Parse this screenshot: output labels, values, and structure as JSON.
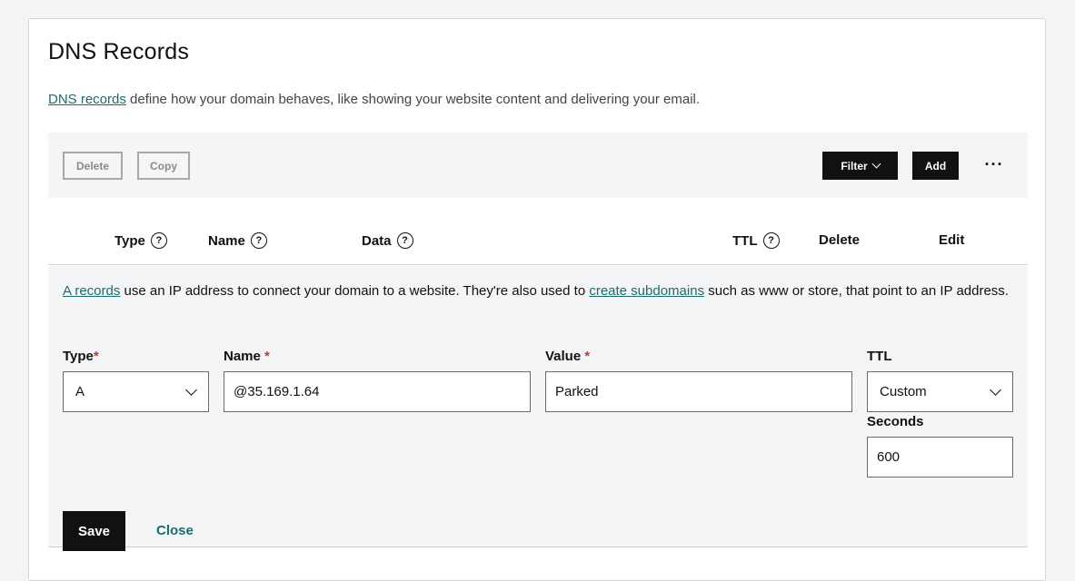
{
  "page": {
    "title": "DNS Records",
    "intro_link": "DNS records",
    "intro_text": " define how your domain behaves, like showing your website content and delivering your email."
  },
  "toolbar": {
    "delete_label": "Delete",
    "copy_label": "Copy",
    "filter_label": "Filter",
    "add_label": "Add",
    "more_label": "···"
  },
  "table_header": {
    "type": "Type",
    "name": "Name",
    "data": "Data",
    "ttl": "TTL",
    "delete": "Delete",
    "edit": "Edit",
    "help_glyph": "?"
  },
  "edit_panel": {
    "info_link1": "A records",
    "info_text1": " use an IP address to connect your domain to a website. They're also used to ",
    "info_link2": "create subdomains",
    "info_text2": " such as www or store, that point to an IP address.",
    "type_label": "Type",
    "name_label": "Name ",
    "value_label": "Value ",
    "ttl_label": "TTL",
    "required_mark": "*",
    "type_value": "A",
    "name_value": "@35.169.1.64",
    "value_value": "Parked",
    "ttl_value": "Custom",
    "seconds_label": "Seconds",
    "seconds_value": "600",
    "save_label": "Save",
    "close_label": "Close"
  },
  "colors": {
    "link": "#1c6b6e",
    "required": "#c0392b",
    "primary_button": "#111111"
  }
}
